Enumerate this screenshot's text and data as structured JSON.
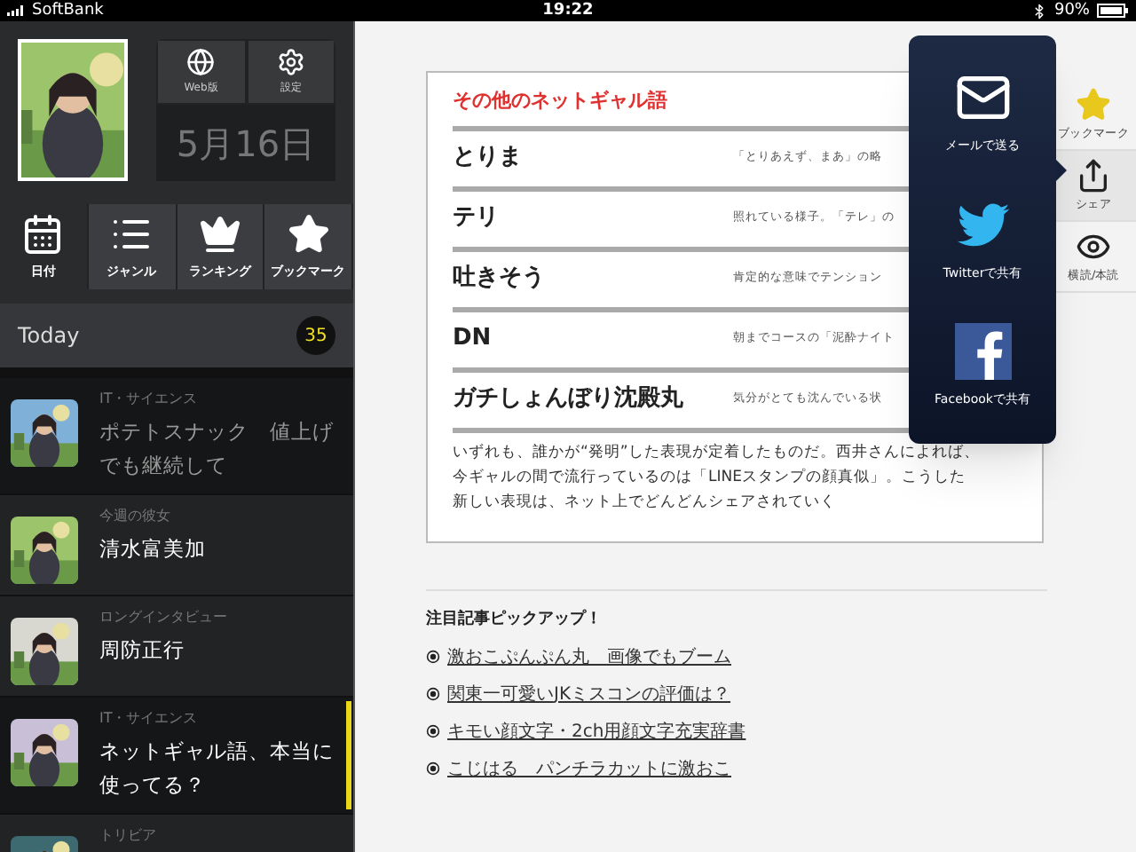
{
  "status_bar": {
    "carrier": "SoftBank",
    "time": "19:22",
    "battery": "90%"
  },
  "sidebar": {
    "quick_buttons": [
      {
        "kind": "globe",
        "label": "Web版"
      },
      {
        "kind": "gear",
        "label": "設定"
      }
    ],
    "date": "5月16日",
    "tabs": [
      {
        "kind": "calendar",
        "label": "日付",
        "selected": true
      },
      {
        "kind": "list",
        "label": "ジャンル",
        "selected": false
      },
      {
        "kind": "crown",
        "label": "ランキング",
        "selected": false
      },
      {
        "kind": "star",
        "label": "ブックマーク",
        "selected": false
      }
    ],
    "section": {
      "title": "Today",
      "count": "35"
    },
    "articles": [
      {
        "category": "IT・サイエンス",
        "title": "ポテトスナック　値上げでも継続して",
        "dimmed": true,
        "selected": false
      },
      {
        "category": "今週の彼女",
        "title": "清水富美加",
        "dimmed": false,
        "selected": false
      },
      {
        "category": "ロングインタビュー",
        "title": "周防正行",
        "dimmed": false,
        "selected": false
      },
      {
        "category": "IT・サイエンス",
        "title": "ネットギャル語、本当に使ってる？",
        "dimmed": false,
        "selected": true
      },
      {
        "category": "トリビア",
        "dimmed": false,
        "selected": false
      }
    ]
  },
  "article": {
    "figure": {
      "title": "その他のネットギャル語",
      "rows": [
        {
          "term": "とりま",
          "meaning": "「とりあえず、まあ」の略"
        },
        {
          "term": "テリ",
          "meaning": "照れている様子。「テレ」の"
        },
        {
          "term": "吐きそう",
          "meaning": "肯定的な意味でテンション"
        },
        {
          "term": "DN",
          "meaning": "朝までコースの「泥酔ナイト"
        },
        {
          "term": "ガチしょんぼり沈殿丸",
          "meaning": "気分がとても沈んでいる状"
        }
      ],
      "caption": [
        "いずれも、誰かが“発明”した表現が定着したものだ。西井さんによれば、",
        "今ギャルの間で流行っているのは「LINEスタンプの顔真似」。こうした",
        "新しい表現は、ネット上でどんどんシェアされていく"
      ]
    },
    "pickup_title": "注目記事ピックアップ！",
    "pickup_links": [
      "激おこぷんぷん丸　画像でもブーム",
      "関東一可愛いJKミスコンの評価は？",
      "キモい顔文字・2ch用顔文字充実辞書",
      "こじはる　パンチラカットに激おこ"
    ]
  },
  "share_menu": [
    {
      "kind": "mail",
      "label": "メールで送る"
    },
    {
      "kind": "twitter",
      "label": "Twitterで共有"
    },
    {
      "kind": "facebook",
      "label": "Facebookで共有"
    }
  ],
  "toolbar": [
    {
      "kind": "star",
      "label": "ブックマーク",
      "selected": false
    },
    {
      "kind": "share",
      "label": "シェア",
      "selected": true
    },
    {
      "kind": "eye",
      "label": "横読/本読",
      "selected": false
    }
  ]
}
